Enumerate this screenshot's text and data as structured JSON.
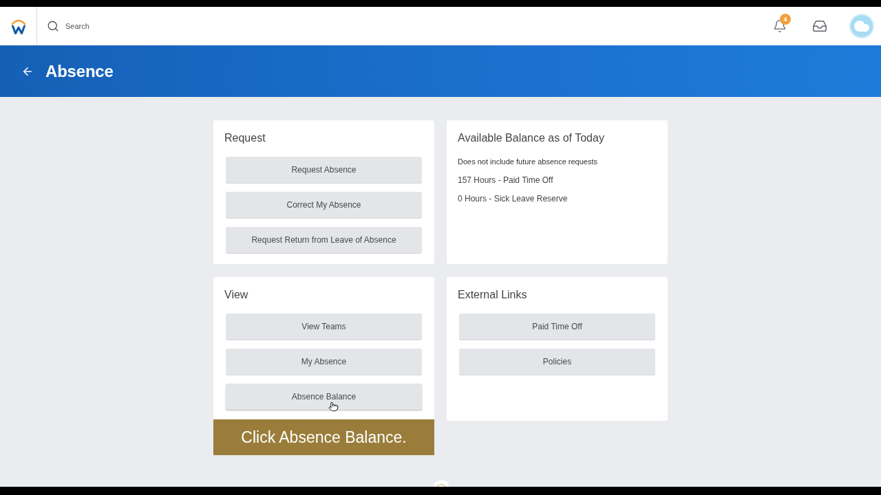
{
  "top_nav": {
    "search": {
      "placeholder": "Search"
    },
    "notifications": {
      "badge": "4"
    }
  },
  "header": {
    "title": "Absence"
  },
  "cards": [
    {
      "kind": "buttons",
      "title": "Request",
      "buttons": [
        {
          "label": "Request Absence",
          "hovered": false
        },
        {
          "label": "Correct My Absence",
          "hovered": false
        },
        {
          "label": "Request Return from Leave of Absence",
          "hovered": false
        }
      ]
    },
    {
      "kind": "text",
      "title": "Available Balance as of Today",
      "note": "Does not include future absence requests",
      "lines": [
        "157 Hours - Paid Time Off",
        "0 Hours - Sick Leave Reserve"
      ]
    },
    {
      "kind": "buttons",
      "title": "View",
      "buttons": [
        {
          "label": "View Teams",
          "hovered": false
        },
        {
          "label": "My Absence",
          "hovered": false
        },
        {
          "label": "Absence Balance",
          "hovered": true
        }
      ],
      "caption": "Click Absence Balance."
    },
    {
      "kind": "buttons",
      "title": "External Links",
      "buttons": [
        {
          "label": "Paid Time Off",
          "hovered": false
        },
        {
          "label": "Policies",
          "hovered": false
        }
      ]
    }
  ]
}
